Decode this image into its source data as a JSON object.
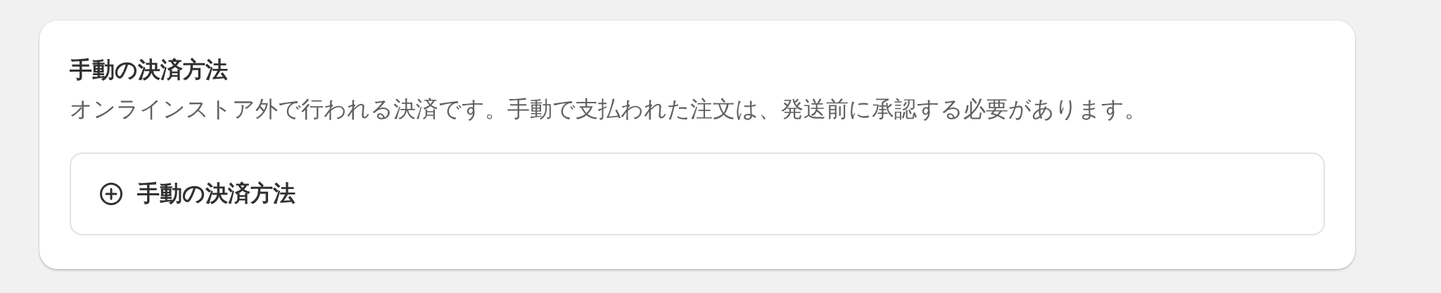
{
  "card": {
    "title": "手動の決済方法",
    "description": "オンラインストア外で行われる決済です。手動で支払われた注文は、発送前に承認する必要があります。",
    "add_button": {
      "label": "手動の決済方法"
    }
  }
}
